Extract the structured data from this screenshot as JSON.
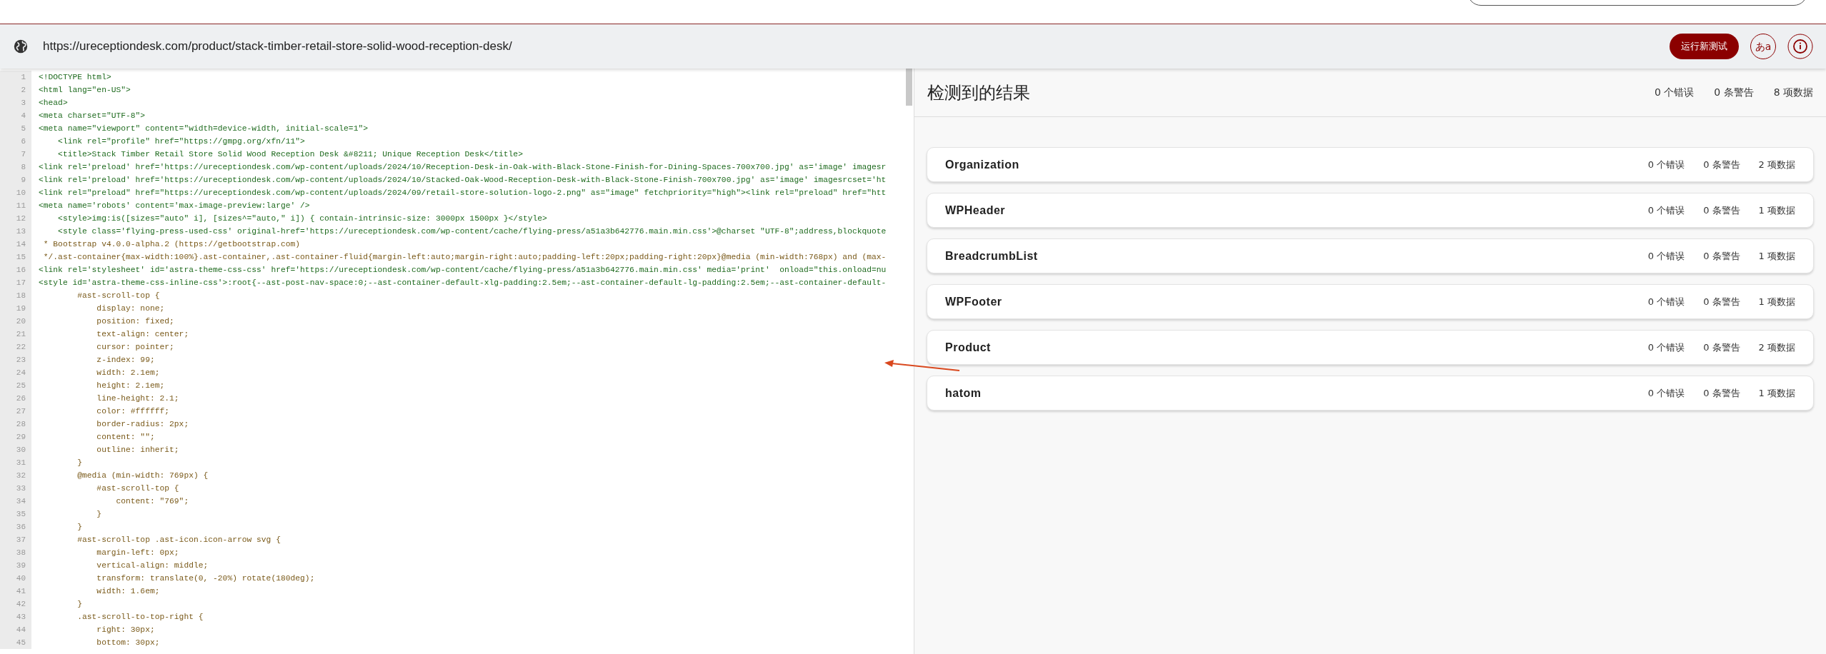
{
  "url_bar": {
    "url": "https://ureceptiondesk.com/product/stack-timber-retail-store-solid-wood-reception-desk/",
    "run_button": "运行新测试",
    "language_button": "あa"
  },
  "code": {
    "lines": [
      {
        "number": "1",
        "kind": "markup",
        "text": "<!DOCTYPE html>"
      },
      {
        "number": "2",
        "kind": "markup",
        "text": "<html lang=\"en-US\">"
      },
      {
        "number": "3",
        "kind": "markup",
        "text": "<head>"
      },
      {
        "number": "4",
        "kind": "markup",
        "text": "<meta charset=\"UTF-8\">"
      },
      {
        "number": "5",
        "kind": "markup",
        "text": "<meta name=\"viewport\" content=\"width=device-width, initial-scale=1\">"
      },
      {
        "number": "6",
        "kind": "markup",
        "text": "    <link rel=\"profile\" href=\"https://gmpg.org/xfn/11\">"
      },
      {
        "number": "7",
        "kind": "markup",
        "text": "    <title>Stack Timber Retail Store Solid Wood Reception Desk &#8211; Unique Reception Desk</title>"
      },
      {
        "number": "8",
        "kind": "markup",
        "text": "<link rel='preload' href='https://ureceptiondesk.com/wp-content/uploads/2024/10/Reception-Desk-in-Oak-with-Black-Stone-Finish-for-Dining-Spaces-700x700.jpg' as='image' imagesr"
      },
      {
        "number": "9",
        "kind": "markup",
        "text": "<link rel='preload' href='https://ureceptiondesk.com/wp-content/uploads/2024/10/Stacked-Oak-Wood-Reception-Desk-with-Black-Stone-Finish-700x700.jpg' as='image' imagesrcset='ht"
      },
      {
        "number": "10",
        "kind": "markup",
        "text": "<link rel=\"preload\" href=\"https://ureceptiondesk.com/wp-content/uploads/2024/09/retail-store-solution-logo-2.png\" as=\"image\" fetchpriority=\"high\"><link rel=\"preload\" href=\"htt"
      },
      {
        "number": "11",
        "kind": "markup",
        "text": "<meta name='robots' content='max-image-preview:large' />"
      },
      {
        "number": "12",
        "kind": "markup",
        "text": "    <style>img:is([sizes=\"auto\" i], [sizes^=\"auto,\" i]) { contain-intrinsic-size: 3000px 1500px }</style>"
      },
      {
        "number": "13",
        "kind": "markup",
        "text": "    <style class='flying-press-used-css' original-href='https://ureceptiondesk.com/wp-content/cache/flying-press/a51a3b642776.main.min.css'>@charset \"UTF-8\";address,blockquote"
      },
      {
        "number": "14",
        "kind": "css",
        "text": " * Bootstrap v4.0.0-alpha.2 (https://getbootstrap.com)"
      },
      {
        "number": "15",
        "kind": "css",
        "text": " */.ast-container{max-width:100%}.ast-container,.ast-container-fluid{margin-left:auto;margin-right:auto;padding-left:20px;padding-right:20px}@media (min-width:768px) and (max-"
      },
      {
        "number": "16",
        "kind": "markup",
        "text": "<link rel='stylesheet' id='astra-theme-css-css' href='https://ureceptiondesk.com/wp-content/cache/flying-press/a51a3b642776.main.min.css' media='print'  onload=\"this.onload=nu"
      },
      {
        "number": "17",
        "kind": "markup",
        "text": "<style id='astra-theme-css-inline-css'>:root{--ast-post-nav-space:0;--ast-container-default-xlg-padding:2.5em;--ast-container-default-lg-padding:2.5em;--ast-container-default-"
      },
      {
        "number": "18",
        "kind": "css",
        "text": "        #ast-scroll-top {"
      },
      {
        "number": "19",
        "kind": "css",
        "text": "            display: none;"
      },
      {
        "number": "20",
        "kind": "css",
        "text": "            position: fixed;"
      },
      {
        "number": "21",
        "kind": "css",
        "text": "            text-align: center;"
      },
      {
        "number": "22",
        "kind": "css",
        "text": "            cursor: pointer;"
      },
      {
        "number": "23",
        "kind": "css",
        "text": "            z-index: 99;"
      },
      {
        "number": "24",
        "kind": "css",
        "text": "            width: 2.1em;"
      },
      {
        "number": "25",
        "kind": "css",
        "text": "            height: 2.1em;"
      },
      {
        "number": "26",
        "kind": "css",
        "text": "            line-height: 2.1;"
      },
      {
        "number": "27",
        "kind": "css",
        "text": "            color: #ffffff;"
      },
      {
        "number": "28",
        "kind": "css",
        "text": "            border-radius: 2px;"
      },
      {
        "number": "29",
        "kind": "css",
        "text": "            content: \"\";"
      },
      {
        "number": "30",
        "kind": "css",
        "text": "            outline: inherit;"
      },
      {
        "number": "31",
        "kind": "css",
        "text": "        }"
      },
      {
        "number": "32",
        "kind": "css",
        "text": "        @media (min-width: 769px) {"
      },
      {
        "number": "33",
        "kind": "css",
        "text": "            #ast-scroll-top {"
      },
      {
        "number": "34",
        "kind": "css",
        "text": "                content: \"769\";"
      },
      {
        "number": "35",
        "kind": "css",
        "text": "            }"
      },
      {
        "number": "36",
        "kind": "css",
        "text": "        }"
      },
      {
        "number": "37",
        "kind": "css",
        "text": "        #ast-scroll-top .ast-icon.icon-arrow svg {"
      },
      {
        "number": "38",
        "kind": "css",
        "text": "            margin-left: 0px;"
      },
      {
        "number": "39",
        "kind": "css",
        "text": "            vertical-align: middle;"
      },
      {
        "number": "40",
        "kind": "css",
        "text": "            transform: translate(0, -20%) rotate(180deg);"
      },
      {
        "number": "41",
        "kind": "css",
        "text": "            width: 1.6em;"
      },
      {
        "number": "42",
        "kind": "css",
        "text": "        }"
      },
      {
        "number": "43",
        "kind": "css",
        "text": "        .ast-scroll-to-top-right {"
      },
      {
        "number": "44",
        "kind": "css",
        "text": "            right: 30px;"
      },
      {
        "number": "45",
        "kind": "css",
        "text": "            bottom: 30px;"
      }
    ]
  },
  "results": {
    "title": "检测到的结果",
    "errors": "0 个错误",
    "warnings": "0 条警告",
    "items_count": "8 项数据",
    "items": [
      {
        "name": "Organization",
        "errors": "0 个错误",
        "warnings": "0 条警告",
        "items": "2 项数据"
      },
      {
        "name": "WPHeader",
        "errors": "0 个错误",
        "warnings": "0 条警告",
        "items": "1 项数据"
      },
      {
        "name": "BreadcrumbList",
        "errors": "0 个错误",
        "warnings": "0 条警告",
        "items": "1 项数据"
      },
      {
        "name": "WPFooter",
        "errors": "0 个错误",
        "warnings": "0 条警告",
        "items": "1 项数据"
      },
      {
        "name": "Product",
        "errors": "0 个错误",
        "warnings": "0 条警告",
        "items": "2 项数据"
      },
      {
        "name": "hatom",
        "errors": "0 个错误",
        "warnings": "0 条警告",
        "items": "1 项数据"
      }
    ]
  }
}
